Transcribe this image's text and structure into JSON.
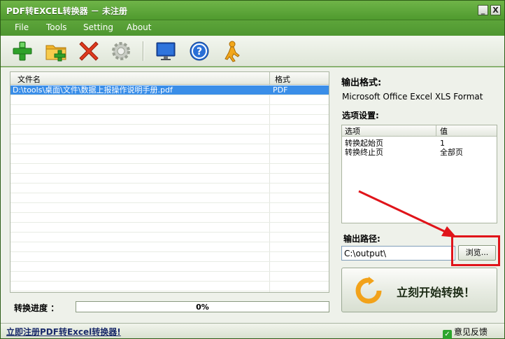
{
  "window": {
    "title": "PDF转EXCEL转换器 － 未注册",
    "minimize_glyph": "_",
    "close_glyph": "X"
  },
  "menu": {
    "items": [
      "File",
      "Tools",
      "Setting",
      "About"
    ]
  },
  "toolbar": {
    "icons": [
      "add-file-icon",
      "add-folder-icon",
      "delete-icon",
      "settings-gear-icon",
      "monitor-icon",
      "help-icon",
      "user-icon"
    ]
  },
  "file_list": {
    "columns": [
      "文件名",
      "格式"
    ],
    "rows": [
      {
        "name": "D:\\tools\\桌面\\文件\\数据上报操作说明手册.pdf",
        "format": "PDF"
      }
    ]
  },
  "output": {
    "format_label": "输出格式:",
    "format_value": "Microsoft Office Excel XLS Format",
    "options_label": "选项设置:",
    "options_columns": [
      "选项",
      "值"
    ],
    "options_rows": [
      {
        "option": "转换起始页",
        "value": "1"
      },
      {
        "option": "转换终止页",
        "value": "全部页"
      }
    ],
    "path_label": "输出路径:",
    "path_value": "C:\\output\\",
    "browse_label": "浏览..."
  },
  "actions": {
    "start_label": "立刻开始转换！"
  },
  "progress": {
    "label": "转换进度 ：",
    "value_text": "0%",
    "value": 0
  },
  "status": {
    "register_link": "立即注册PDF转Excel转换器!",
    "feedback_label": "意见反馈"
  },
  "colors": {
    "accent_green": "#4f9a2e",
    "selection_blue": "#3a8ee8",
    "annotation_red": "#e0141a"
  }
}
